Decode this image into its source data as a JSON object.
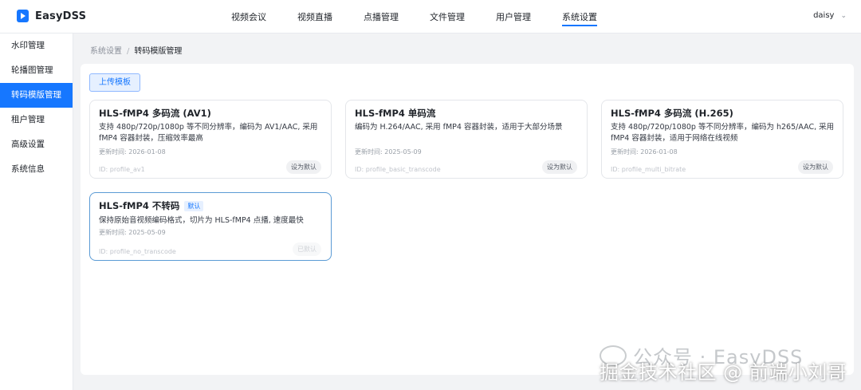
{
  "app": {
    "name": "EasyDSS"
  },
  "nav": {
    "items": [
      "视频会议",
      "视频直播",
      "点播管理",
      "文件管理",
      "用户管理",
      "系统设置"
    ],
    "active": "系统设置"
  },
  "user": {
    "name": "daisy"
  },
  "sidebar": {
    "items": [
      "水印管理",
      "轮播图管理",
      "转码模版管理",
      "租户管理",
      "高级设置",
      "系统信息"
    ],
    "active": "转码模版管理"
  },
  "breadcrumb": {
    "parent": "系统设置",
    "separator": "/",
    "current": "转码模版管理"
  },
  "toolbar": {
    "upload_label": "上传模板"
  },
  "templates": [
    {
      "title": "HLS-fMP4 多码流 (AV1)",
      "desc": "支持 480p/720p/1080p 等不同分辨率，编码为 AV1/AAC, 采用 fMP4 容器封装，压缩效率最高",
      "updated": "更新时间: 2026-01-08",
      "id": "ID: profile_av1",
      "action": "设为默认"
    },
    {
      "title": "HLS-fMP4 单码流",
      "desc": "编码为 H.264/AAC, 采用 fMP4 容器封装，适用于大部分场景",
      "updated": "更新时间: 2025-05-09",
      "id": "ID: profile_basic_transcode",
      "action": "设为默认"
    },
    {
      "title": "HLS-fMP4 多码流 (H.265)",
      "desc": "支持 480p/720p/1080p 等不同分辨率，编码为 h265/AAC, 采用 fMP4 容器封装，适用于网络在线视频",
      "updated": "更新时间: 2026-01-08",
      "id": "ID: profile_multi_bitrate",
      "action": "设为默认"
    },
    {
      "title": "HLS-fMP4 不转码",
      "badge": "默认",
      "desc": "保持原始音视频编码格式，切片为 HLS-fMP4 点播, 速度最快",
      "updated": "更新时间: 2025-05-09",
      "id": "ID: profile_no_transcode",
      "action": "已默认"
    }
  ],
  "watermark": {
    "line1": "公众号 · EasyDSS",
    "line2": "掘金技术社区 @ 前端小刘哥"
  },
  "colors": {
    "accent": "#1677ff",
    "selected_border": "#5b9bd5"
  }
}
